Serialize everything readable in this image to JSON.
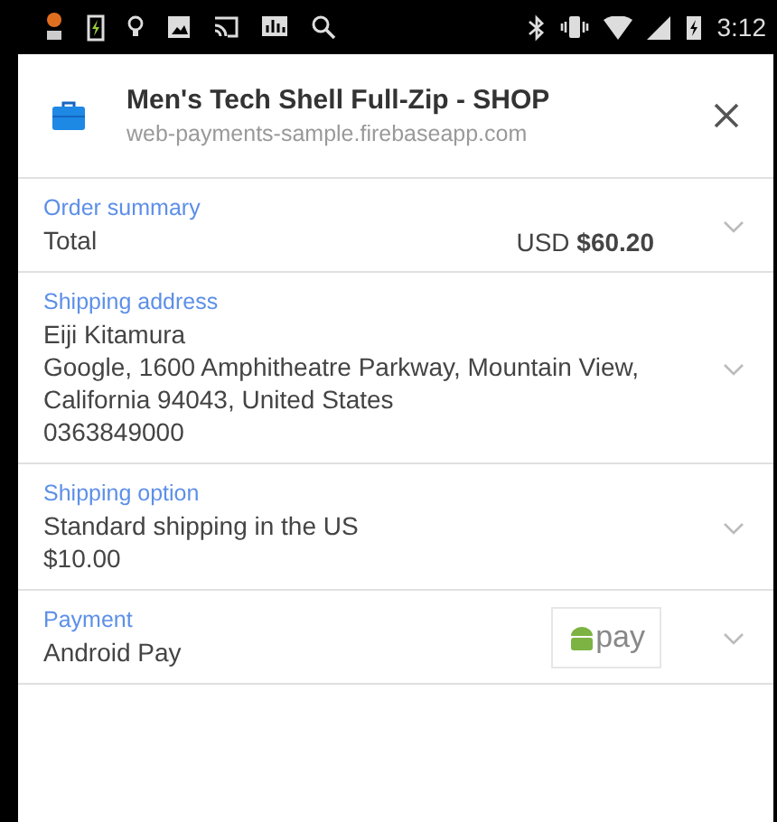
{
  "status_bar": {
    "time": "3:12"
  },
  "header": {
    "title": "Men's Tech Shell Full-Zip - SHOP",
    "subtitle": "web-payments-sample.firebaseapp.com"
  },
  "sections": [
    {
      "kind": "total",
      "label": "Order summary",
      "lines": [
        "Total"
      ],
      "currency": "USD",
      "amount": "$60.20"
    },
    {
      "kind": "text",
      "label": "Shipping address",
      "lines": [
        "Eiji Kitamura",
        "Google, 1600 Amphitheatre Parkway, Mountain View, California 94043, United States",
        "0363849000"
      ]
    },
    {
      "kind": "text",
      "label": "Shipping option",
      "lines": [
        "Standard shipping in the US",
        "$10.00"
      ]
    },
    {
      "kind": "payment",
      "label": "Payment",
      "lines": [
        "Android Pay"
      ],
      "badge": "pay"
    }
  ]
}
